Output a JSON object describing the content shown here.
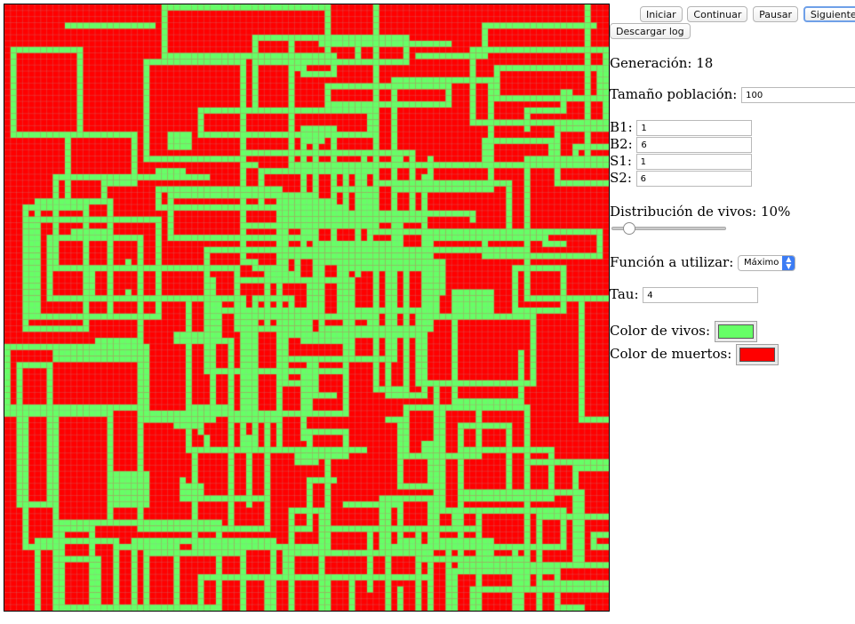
{
  "buttons": {
    "iniciar": "Iniciar",
    "continuar": "Continuar",
    "pausar": "Pausar",
    "siguiente": "Siguiente",
    "descargar_log": "Descargar log"
  },
  "generation": {
    "label": "Generación:",
    "value": "18"
  },
  "population": {
    "label": "Tamaño población:",
    "value": "100"
  },
  "rules": {
    "b1": {
      "label": "B1:",
      "value": "1"
    },
    "b2": {
      "label": "B2:",
      "value": "6"
    },
    "s1": {
      "label": "S1:",
      "value": "1"
    },
    "s2": {
      "label": "S2:",
      "value": "6"
    }
  },
  "distribution": {
    "label": "Distribución de vivos:",
    "value_text": "10%",
    "value": 0.1
  },
  "function": {
    "label": "Función a utilizar:",
    "selected": "Máximo"
  },
  "tau": {
    "label": "Tau:",
    "value": "4"
  },
  "colors": {
    "alive_label": "Color de vivos:",
    "dead_label": "Color de muertos:",
    "alive": "#66ff66",
    "dead": "#ff0000",
    "grid": "#b0b0b0"
  },
  "board": {
    "rows": 100,
    "cols": 100
  }
}
